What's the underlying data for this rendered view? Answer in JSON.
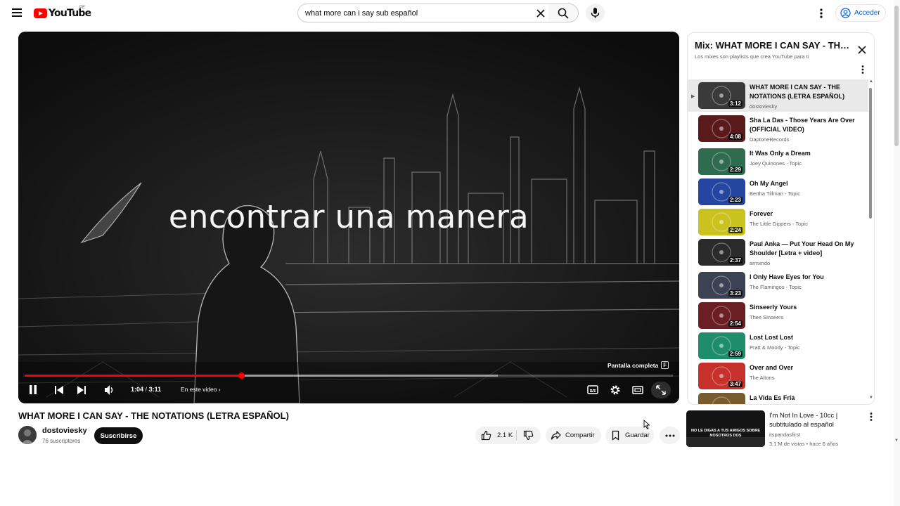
{
  "header": {
    "logo_text": "YouTube",
    "country_code": "PE",
    "search_value": "what more can i say sub español",
    "signin_label": "Acceder"
  },
  "player": {
    "caption": "encontrar una manera",
    "tooltip_label": "Pantalla completa",
    "tooltip_key": "F",
    "time_current": "1:04",
    "time_separator": "/",
    "time_total": "3:11",
    "chapter_label": "En este video",
    "progress_fraction": 0.335,
    "buffer_fraction": 0.73
  },
  "video": {
    "title": "WHAT MORE I CAN SAY - THE NOTATIONS (LETRA ESPAÑOL)",
    "channel": "dostoviesky",
    "subscribers": "76 suscriptores",
    "subscribe_label": "Suscribirse",
    "likes": "2.1 K",
    "share_label": "Compartir",
    "save_label": "Guardar"
  },
  "playlist": {
    "title": "Mix: WHAT MORE I CAN SAY - THE NOTATIONS (LETRA ESPAÑOL)",
    "subtitle": "Los mixes son playlists que crea YouTube para ti",
    "current_marker": "▶",
    "items": [
      {
        "title": "WHAT MORE I CAN SAY - THE NOTATIONS (LETRA ESPAÑOL)",
        "channel": "dostoviesky",
        "duration": "3:12",
        "color": "#3a3a3a"
      },
      {
        "title": "Sha La Das - Those Years Are Over (OFFICIAL VIDEO)",
        "channel": "DaptoneRecords",
        "duration": "4:08",
        "color": "#5a1a1c"
      },
      {
        "title": "It Was Only a Dream",
        "channel": "Joey Quinones - Topic",
        "duration": "2:29",
        "color": "#2f6b4e"
      },
      {
        "title": "Oh My Angel",
        "channel": "Bertha Tillman - Topic",
        "duration": "2:23",
        "color": "#2445a0"
      },
      {
        "title": "Forever",
        "channel": "The Little Dippers - Topic",
        "duration": "2:24",
        "color": "#c9c21f"
      },
      {
        "title": "Paul Anka — Put Your Head On My Shoulder [Letra + video]",
        "channel": "armxndo",
        "duration": "2:37",
        "color": "#2b2b2b"
      },
      {
        "title": "I Only Have Eyes for You",
        "channel": "The Flamingos - Topic",
        "duration": "3:23",
        "color": "#3c4254"
      },
      {
        "title": "Sinseerly Yours",
        "channel": "Thee Sinseers",
        "duration": "2:54",
        "color": "#6b1f24"
      },
      {
        "title": "Lost Lost Lost",
        "channel": "Pratt & Moody - Topic",
        "duration": "2:59",
        "color": "#1e8e6a"
      },
      {
        "title": "Over and Over",
        "channel": "The Altons",
        "duration": "3:47",
        "color": "#c6312b"
      },
      {
        "title": "La Vida Es Fría",
        "channel": "",
        "duration": "",
        "color": "#7a5b2e"
      }
    ]
  },
  "recommendation": {
    "title": "I'm Not In Love - 10cc | subtitulado al español",
    "channel": "itspandasfirst",
    "views": "3.1 M de vistas",
    "dot": "•",
    "age": "hace 6 años",
    "thumb_text": "NO LE DIGAS A TUS AMIGOS SOBRE NOSOTROS DOS"
  },
  "colors": {
    "accent_red": "#ff0000",
    "link_blue": "#065fd4"
  }
}
